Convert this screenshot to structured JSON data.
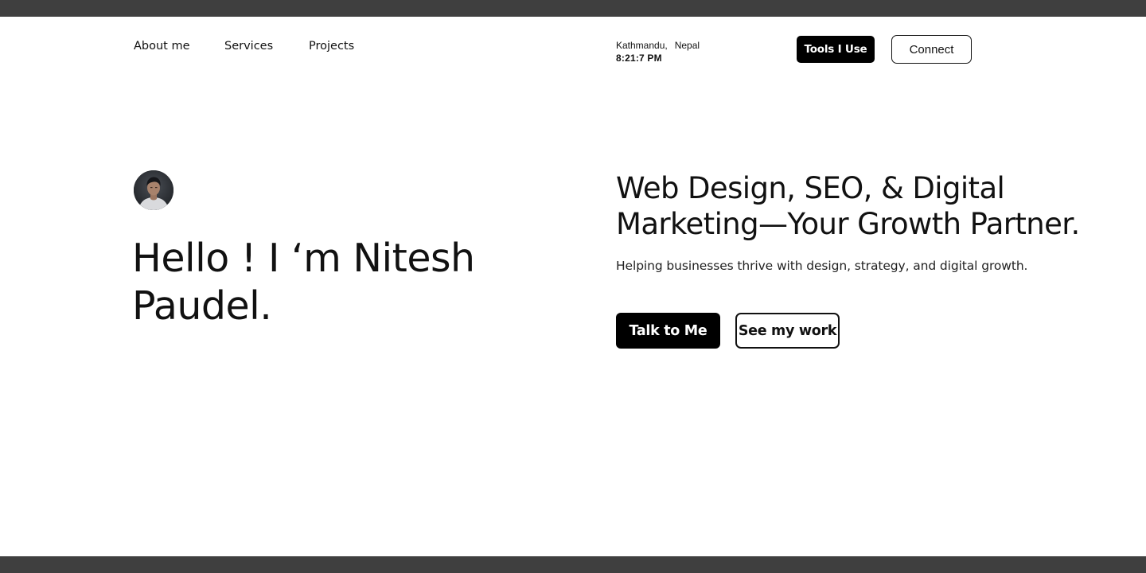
{
  "nav": {
    "links": [
      {
        "label": "About me"
      },
      {
        "label": "Services"
      },
      {
        "label": "Projects"
      }
    ]
  },
  "location": {
    "city": "Kathmandu,",
    "country": "Nepal",
    "time": "8:21:7  PM"
  },
  "header_buttons": {
    "tools_label": "Tools I Use",
    "connect_label": "Connect"
  },
  "hero": {
    "greeting_line1": "Hello !  I ‘m Nitesh",
    "greeting_line2": "Paudel.",
    "headline_line1": "Web Design, SEO, & Digital",
    "headline_line2": "Marketing—Your Growth Partner.",
    "subheadline": "Helping businesses thrive with design, strategy, and digital growth.",
    "primary_cta": "Talk to Me",
    "secondary_cta": "See my work"
  },
  "colors": {
    "frame": "#3f3f3f",
    "background": "#ffffff",
    "accent": "#000000"
  },
  "icons": {
    "avatar": "profile-photo"
  }
}
